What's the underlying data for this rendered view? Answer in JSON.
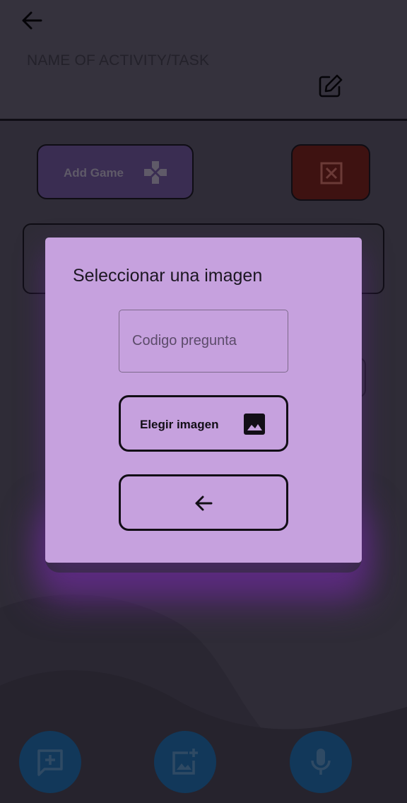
{
  "header": {
    "activity_title_placeholder": "NAME OF ACTIVITY/TASK",
    "back_icon": "arrow-left-icon",
    "edit_icon": "edit-icon"
  },
  "toolbar": {
    "add_game_label": "Add Game",
    "add_game_icon": "gamepad-icon",
    "delete_icon": "close-box-icon"
  },
  "dialog": {
    "title": "Seleccionar una imagen",
    "code_field": {
      "placeholder": "Codigo pregunta",
      "value": ""
    },
    "choose_image_label": "Elegir imagen",
    "choose_image_icon": "image-icon",
    "back_icon": "arrow-left-icon"
  },
  "fabs": [
    {
      "icon": "add-comment-icon"
    },
    {
      "icon": "add-photo-icon"
    },
    {
      "icon": "mic-icon"
    }
  ],
  "colors": {
    "dialog_background": "#c6a1de",
    "add_game_background": "#3a2d52",
    "delete_background": "#3e1211",
    "fab_background": "#12385a",
    "page_background": "#2f2c37"
  }
}
